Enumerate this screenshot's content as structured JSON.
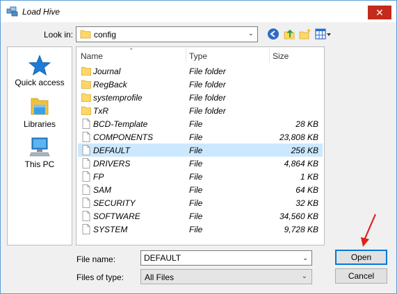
{
  "window": {
    "title": "Load Hive",
    "close_glyph": "✕"
  },
  "toolbar": {
    "lookin_label": "Look in:",
    "lookin_value": "config",
    "buttons": [
      "back-icon",
      "up-folder-icon",
      "new-folder-icon",
      "view-menu-icon"
    ]
  },
  "places": [
    {
      "label": "Quick access",
      "icon": "star-icon"
    },
    {
      "label": "Libraries",
      "icon": "libraries-icon"
    },
    {
      "label": "This PC",
      "icon": "computer-icon"
    }
  ],
  "columns": {
    "name": "Name",
    "type": "Type",
    "size": "Size"
  },
  "files": [
    {
      "name": "Journal",
      "type": "File folder",
      "size": "",
      "kind": "folder"
    },
    {
      "name": "RegBack",
      "type": "File folder",
      "size": "",
      "kind": "folder"
    },
    {
      "name": "systemprofile",
      "type": "File folder",
      "size": "",
      "kind": "folder"
    },
    {
      "name": "TxR",
      "type": "File folder",
      "size": "",
      "kind": "folder"
    },
    {
      "name": "BCD-Template",
      "type": "File",
      "size": "28 KB",
      "kind": "file"
    },
    {
      "name": "COMPONENTS",
      "type": "File",
      "size": "23,808 KB",
      "kind": "file"
    },
    {
      "name": "DEFAULT",
      "type": "File",
      "size": "256 KB",
      "kind": "file",
      "selected": true
    },
    {
      "name": "DRIVERS",
      "type": "File",
      "size": "4,864 KB",
      "kind": "file"
    },
    {
      "name": "FP",
      "type": "File",
      "size": "1 KB",
      "kind": "file"
    },
    {
      "name": "SAM",
      "type": "File",
      "size": "64 KB",
      "kind": "file"
    },
    {
      "name": "SECURITY",
      "type": "File",
      "size": "32 KB",
      "kind": "file"
    },
    {
      "name": "SOFTWARE",
      "type": "File",
      "size": "34,560 KB",
      "kind": "file"
    },
    {
      "name": "SYSTEM",
      "type": "File",
      "size": "9,728 KB",
      "kind": "file"
    }
  ],
  "footer": {
    "filename_label": "File name:",
    "filename_value": "DEFAULT",
    "filetype_label": "Files of type:",
    "filetype_value": "All Files",
    "open_label": "Open",
    "cancel_label": "Cancel"
  },
  "colors": {
    "selection": "#cce8ff",
    "accent": "#0078d7",
    "close": "#c42b1c",
    "annotation_arrow": "#e0201c",
    "folder": "#ffd766"
  }
}
